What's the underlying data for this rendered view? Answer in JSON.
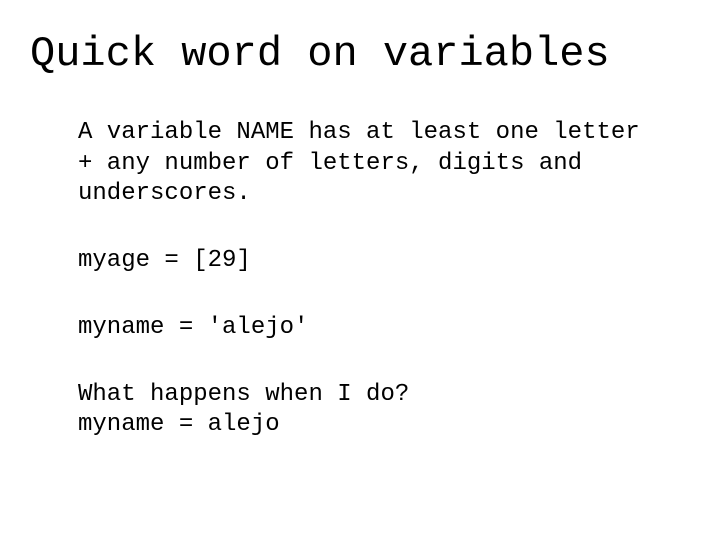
{
  "title": "Quick word on variables",
  "paragraphs": {
    "p1": "A variable NAME has at least one letter + any number of letters, digits and underscores.",
    "p2": "myage = [29]",
    "p3": "myname  = 'alejo'",
    "p4": "What happens when I do?",
    "p5": "myname = alejo"
  }
}
